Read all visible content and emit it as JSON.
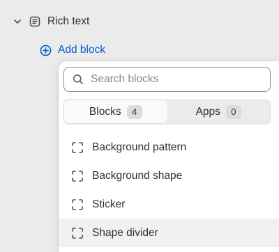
{
  "section": {
    "label": "Rich text",
    "chevron_icon": "chevron-down-icon",
    "icon": "text-block-icon"
  },
  "add_block": {
    "label": "Add block",
    "icon": "plus-circle-icon",
    "color": "#005bd3"
  },
  "popover": {
    "search": {
      "placeholder": "Search blocks",
      "value": "",
      "icon": "search-icon"
    },
    "tabs": [
      {
        "label": "Blocks",
        "count": "4",
        "active": true
      },
      {
        "label": "Apps",
        "count": "0",
        "active": false
      }
    ],
    "items": [
      {
        "label": "Background pattern",
        "icon": "block-placeholder-icon"
      },
      {
        "label": "Background shape",
        "icon": "block-placeholder-icon"
      },
      {
        "label": "Sticker",
        "icon": "block-placeholder-icon"
      },
      {
        "label": "Shape divider",
        "icon": "block-placeholder-icon"
      }
    ]
  }
}
